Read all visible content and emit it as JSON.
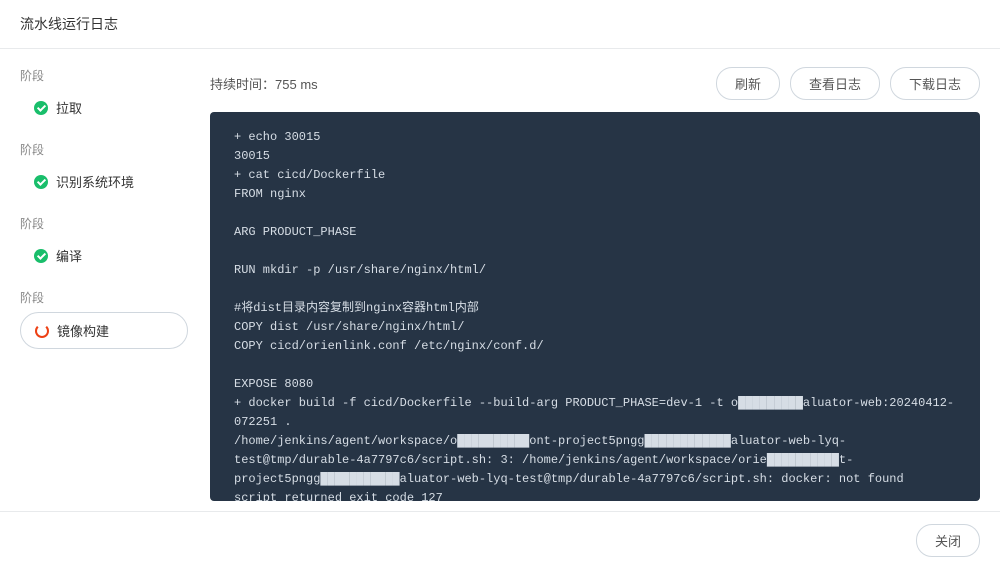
{
  "header": {
    "title": "流水线运行日志"
  },
  "sidebar": {
    "stage_label": "阶段",
    "items": [
      {
        "label": "拉取",
        "status": "success"
      },
      {
        "label": "识别系统环境",
        "status": "success"
      },
      {
        "label": "编译",
        "status": "success"
      },
      {
        "label": "镜像构建",
        "status": "running"
      }
    ]
  },
  "main": {
    "duration_label": "持续时间：",
    "duration_value": "755 ms",
    "buttons": {
      "refresh": "刷新",
      "view_log": "查看日志",
      "download_log": "下载日志"
    }
  },
  "log_lines": [
    "+ echo 30015",
    "30015",
    "+ cat cicd/Dockerfile",
    "FROM nginx",
    "",
    "ARG PRODUCT_PHASE",
    "",
    "RUN mkdir -p /usr/share/nginx/html/",
    "",
    "#将dist目录内容复制到nginx容器html内部",
    "COPY dist /usr/share/nginx/html/",
    "COPY cicd/orienlink.conf /etc/nginx/conf.d/",
    "",
    "EXPOSE 8080",
    "+ docker build -f cicd/Dockerfile --build-arg PRODUCT_PHASE=dev-1 -t o█████████aluator-web:20240412-072251 .",
    "/home/jenkins/agent/workspace/o██████████ont-project5pngg████████████aluator-web-lyq-test@tmp/durable-4a7797c6/script.sh: 3: /home/jenkins/agent/workspace/orie██████████t-project5pngg███████████aluator-web-lyq-test@tmp/durable-4a7797c6/script.sh: docker: not found",
    "script returned exit code 127"
  ],
  "footer": {
    "close": "关闭"
  }
}
